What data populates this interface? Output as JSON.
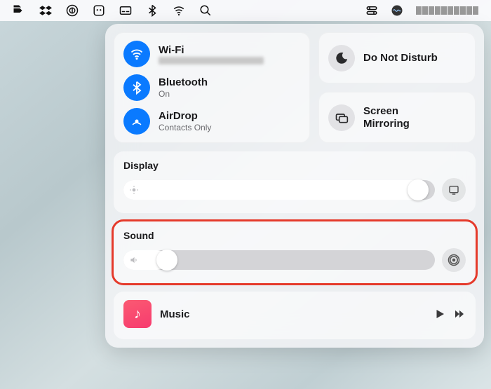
{
  "menubar": {
    "left_icons": [
      "pass-icon",
      "dropbox-icon",
      "onepassword-icon",
      "app-icon",
      "subtitle-icon",
      "bluetooth-icon",
      "wifi-icon",
      "search-icon"
    ],
    "right_icons": [
      "control-center-icon",
      "siri-icon"
    ]
  },
  "control_center": {
    "wifi": {
      "title": "Wi-Fi",
      "subtitle_redacted": true
    },
    "bluetooth": {
      "title": "Bluetooth",
      "subtitle": "On"
    },
    "airdrop": {
      "title": "AirDrop",
      "subtitle": "Contacts Only"
    },
    "dnd": {
      "title": "Do Not Disturb"
    },
    "screen_mirroring": {
      "title": "Screen Mirroring"
    },
    "display": {
      "title": "Display",
      "slider_percent": 98
    },
    "sound": {
      "title": "Sound",
      "slider_percent": 14,
      "highlighted": true
    },
    "music": {
      "title": "Music"
    }
  },
  "colors": {
    "accent": "#0a7aff",
    "highlight": "#e53a2b"
  }
}
